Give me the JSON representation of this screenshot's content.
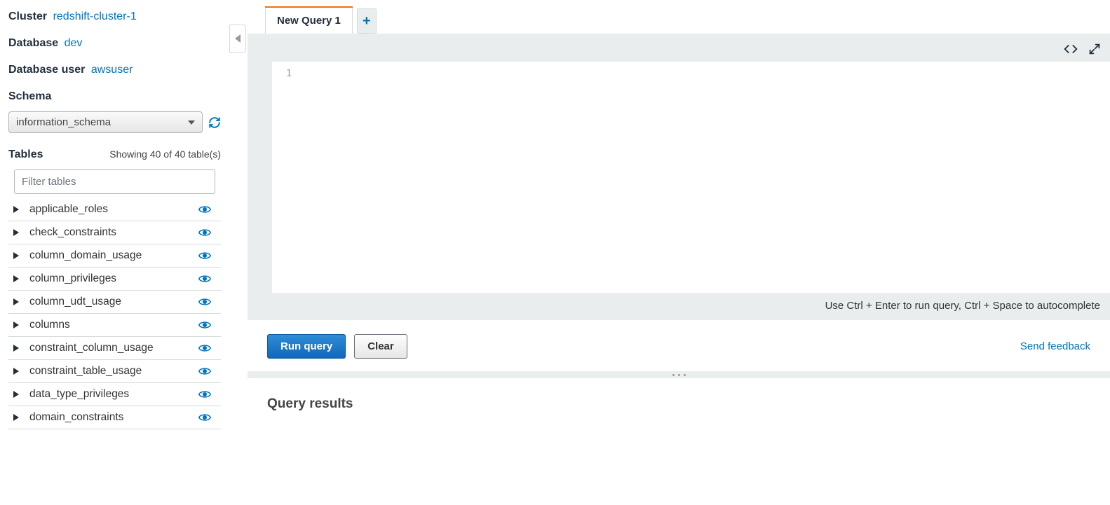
{
  "sidebar": {
    "cluster_label": "Cluster",
    "cluster_value": "redshift-cluster-1",
    "database_label": "Database",
    "database_value": "dev",
    "dbuser_label": "Database user",
    "dbuser_value": "awsuser",
    "schema_label": "Schema",
    "schema_value": "information_schema",
    "tables_label": "Tables",
    "tables_count": "Showing 40 of 40 table(s)",
    "filter_placeholder": "Filter tables",
    "tables": [
      {
        "name": "applicable_roles"
      },
      {
        "name": "check_constraints"
      },
      {
        "name": "column_domain_usage"
      },
      {
        "name": "column_privileges"
      },
      {
        "name": "column_udt_usage"
      },
      {
        "name": "columns"
      },
      {
        "name": "constraint_column_usage"
      },
      {
        "name": "constraint_table_usage"
      },
      {
        "name": "data_type_privileges"
      },
      {
        "name": "domain_constraints"
      }
    ]
  },
  "tabs": {
    "items": [
      {
        "label": "New Query 1"
      }
    ]
  },
  "editor": {
    "line_number": "1",
    "hint": "Use Ctrl + Enter to run query, Ctrl + Space to autocomplete"
  },
  "actions": {
    "run": "Run query",
    "clear": "Clear",
    "feedback": "Send feedback"
  },
  "results": {
    "title": "Query results"
  }
}
